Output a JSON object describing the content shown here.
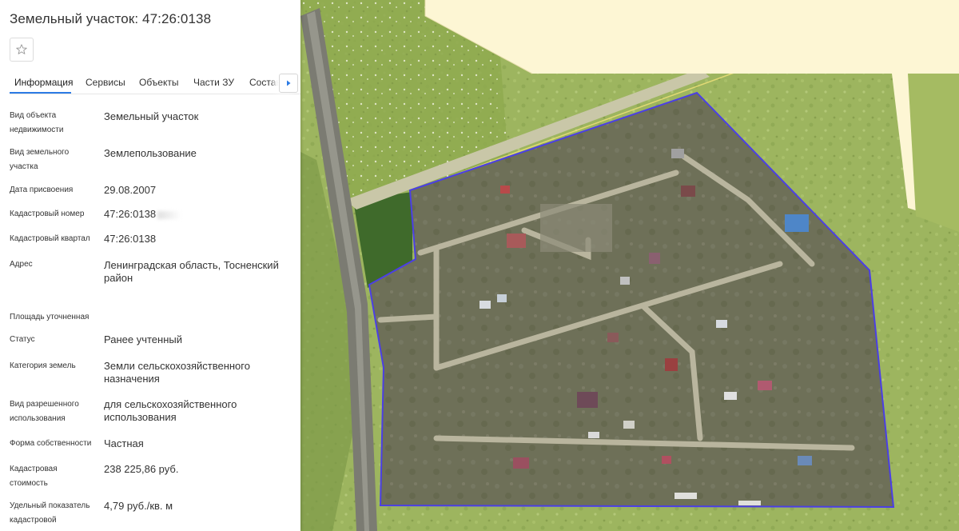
{
  "panel": {
    "title": "Земельный участок: 47:26:0138",
    "tabs": [
      {
        "label": "Информация"
      },
      {
        "label": "Сервисы"
      },
      {
        "label": "Объекты"
      },
      {
        "label": "Части ЗУ"
      },
      {
        "label": "Состав"
      }
    ],
    "properties": [
      {
        "label": "Вид объекта недвижимости",
        "value": "Земельный участок"
      },
      {
        "label": "Вид земельного участка",
        "value": "Землепользование"
      },
      {
        "label": "Дата присвоения",
        "value": "29.08.2007"
      },
      {
        "label": "Кадастровый номер",
        "value": "47:26:0138"
      },
      {
        "label": "Кадастровый квартал",
        "value": "47:26:0138"
      },
      {
        "label": "Адрес",
        "value": "Ленинградская область, Тосненский район"
      },
      {
        "label": "Площадь уточненная",
        "value": ""
      },
      {
        "label": "Статус",
        "value": "Ранее учтенный"
      },
      {
        "label": "Категория земель",
        "value": "Земли сельскохозяйственного назначения"
      },
      {
        "label": "Вид разрешенного использования",
        "value": "для сельскохозяйственного использования"
      },
      {
        "label": "Форма собственности",
        "value": "Частная"
      },
      {
        "label": "Кадастровая стоимость",
        "value": "238 225,86 руб."
      },
      {
        "label": "Удельный показатель кадастровой",
        "value": "4,79 руб./кв. м"
      }
    ]
  },
  "icons": {
    "favorite": "star-outline-icon",
    "tabs_next": "caret-right-icon"
  },
  "colors": {
    "accent": "#2c7be5",
    "parcel_outline": "#4b3fe6",
    "map_background": "#fdf6d4",
    "vegetation": "#9ab35c"
  }
}
